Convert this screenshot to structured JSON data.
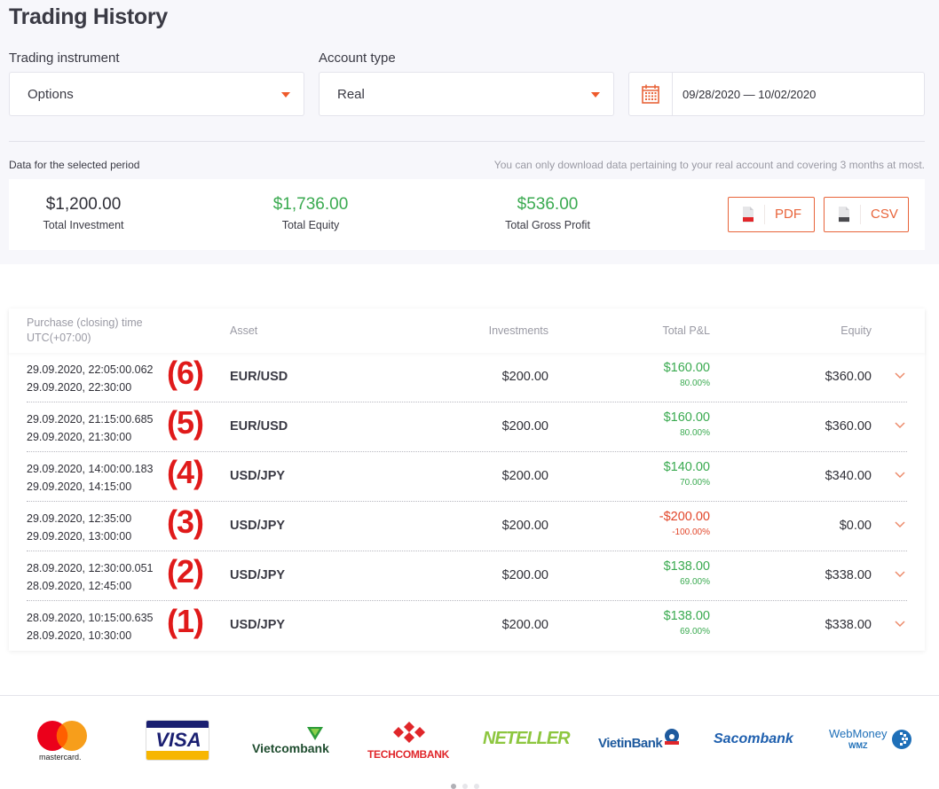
{
  "page": {
    "title": "Trading History"
  },
  "filters": {
    "instrument": {
      "label": "Trading instrument",
      "value": "Options"
    },
    "account": {
      "label": "Account type",
      "value": "Real"
    },
    "date_range": {
      "value": "09/28/2020 — 10/02/2020",
      "icon": "calendar-icon"
    }
  },
  "summary": {
    "period_label": "Data for the selected period",
    "note": "You can only download data pertaining to your real account and covering 3 months at most.",
    "stats": [
      {
        "amount": "$1,200.00",
        "caption": "Total Investment"
      },
      {
        "amount": "$1,736.00",
        "caption": "Total Equity"
      },
      {
        "amount": "$536.00",
        "caption": "Total Gross Profit"
      }
    ],
    "downloads": [
      {
        "label": "PDF",
        "icon": "pdf-file-icon",
        "badge": "PDF"
      },
      {
        "label": "CSV",
        "icon": "csv-file-icon",
        "badge": "CSV"
      }
    ]
  },
  "table": {
    "headers": {
      "time_line1": "Purchase (closing) time",
      "time_line2": "UTC(+07:00)",
      "asset": "Asset",
      "investments": "Investments",
      "pnl": "Total P&L",
      "equity": "Equity"
    },
    "rows": [
      {
        "marker": "(6)",
        "open": "29.09.2020, 22:05:00.062",
        "close": "29.09.2020, 22:30:00",
        "asset": "EUR/USD",
        "investment": "$200.00",
        "pnl": "$160.00",
        "pnl_pct": "80.00%",
        "equity": "$360.00"
      },
      {
        "marker": "(5)",
        "open": "29.09.2020, 21:15:00.685",
        "close": "29.09.2020, 21:30:00",
        "asset": "EUR/USD",
        "investment": "$200.00",
        "pnl": "$160.00",
        "pnl_pct": "80.00%",
        "equity": "$360.00"
      },
      {
        "marker": "(4)",
        "open": "29.09.2020, 14:00:00.183",
        "close": "29.09.2020, 14:15:00",
        "asset": "USD/JPY",
        "investment": "$200.00",
        "pnl": "$140.00",
        "pnl_pct": "70.00%",
        "equity": "$340.00"
      },
      {
        "marker": "(3)",
        "open": "29.09.2020, 12:35:00",
        "close": "29.09.2020, 13:00:00",
        "asset": "USD/JPY",
        "investment": "$200.00",
        "pnl": "-$200.00",
        "pnl_pct": "-100.00%",
        "equity": "$0.00"
      },
      {
        "marker": "(2)",
        "open": "28.09.2020, 12:30:00.051",
        "close": "28.09.2020, 12:45:00",
        "asset": "USD/JPY",
        "investment": "$200.00",
        "pnl": "$138.00",
        "pnl_pct": "69.00%",
        "equity": "$338.00"
      },
      {
        "marker": "(1)",
        "open": "28.09.2020, 10:15:00.635",
        "close": "28.09.2020, 10:30:00",
        "asset": "USD/JPY",
        "investment": "$200.00",
        "pnl": "$138.00",
        "pnl_pct": "69.00%",
        "equity": "$338.00"
      }
    ]
  },
  "footer": {
    "logos": [
      {
        "name": "mastercard",
        "text": "mastercard."
      },
      {
        "name": "visa",
        "text": "VISA"
      },
      {
        "name": "vietcombank",
        "text": "Vietcombank"
      },
      {
        "name": "techcombank",
        "text": "TECHCOMBANK"
      },
      {
        "name": "neteller",
        "text": "NETELLER"
      },
      {
        "name": "vietinbank",
        "text": "VietinBank"
      },
      {
        "name": "sacombank",
        "text": "Sacombank"
      },
      {
        "name": "webmoney",
        "text": "WebMoney",
        "subtext": "WMZ"
      }
    ],
    "carousel": {
      "pages": 3,
      "active": 1
    }
  },
  "colors": {
    "accent": "#e8643a",
    "positive": "#3aaa50",
    "negative": "#e2462a",
    "marker": "#e01a1a"
  }
}
